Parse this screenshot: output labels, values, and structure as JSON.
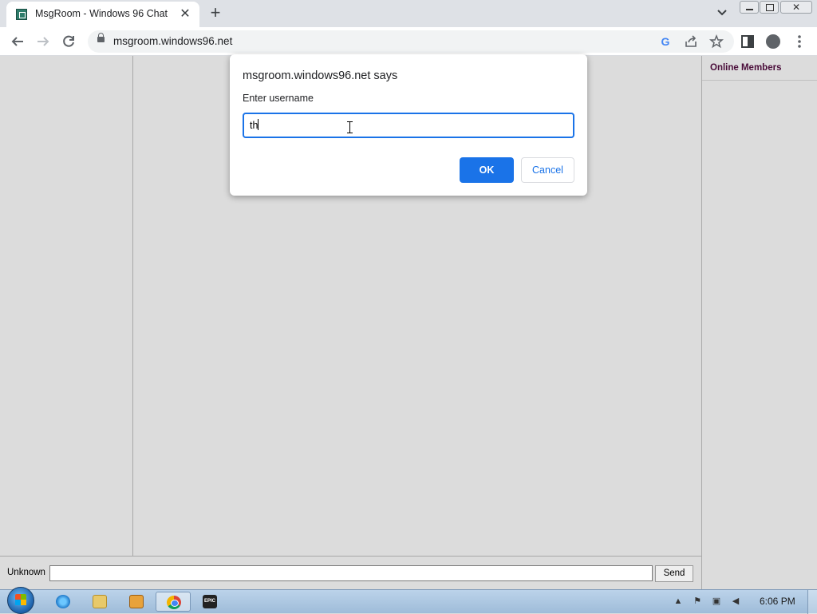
{
  "browser": {
    "tab": {
      "title": "MsgRoom - Windows 96 Chat",
      "favicon": "msgroom-icon",
      "close_symbol": "✕"
    },
    "new_tab_symbol": "+",
    "address": {
      "url": "msgroom.windows96.net"
    },
    "colors": {
      "tabstrip": "#dee1e6",
      "accent": "#1a73e8"
    }
  },
  "page": {
    "right_pane": {
      "title": "Online Members"
    },
    "bottom_bar": {
      "username": "Unknown",
      "message_value": "",
      "send_label": "Send"
    },
    "colors": {
      "background": "#dcdcdc",
      "members_title": "#4a0d3a"
    }
  },
  "dialog": {
    "title": "msgroom.windows96.net says",
    "message": "Enter username",
    "input_value": "th",
    "ok_label": "OK",
    "cancel_label": "Cancel"
  },
  "taskbar": {
    "apps": [
      "internet-explorer-icon",
      "folder-icon",
      "media-player-icon",
      "chrome-icon",
      "epic-games-icon"
    ],
    "active_app": "chrome-icon",
    "clock": "6:06 PM"
  }
}
